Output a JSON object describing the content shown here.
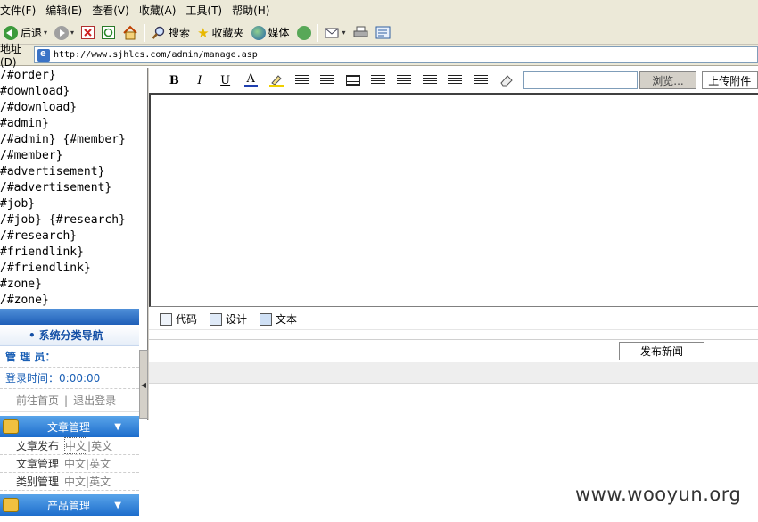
{
  "menubar": {
    "items": [
      "文件(F)",
      "编辑(E)",
      "查看(V)",
      "收藏(A)",
      "工具(T)",
      "帮助(H)"
    ]
  },
  "toolbar": {
    "back": "后退",
    "search": "搜索",
    "favorites": "收藏夹",
    "media": "媒体"
  },
  "address": {
    "label": "地址(D)",
    "url": "http://www.sjhlcs.com/admin/manage.asp"
  },
  "code_lines": [
    "/#order}",
    "#download}",
    "/#download}",
    "#admin}",
    "/#admin} {#member}",
    "/#member}",
    "#advertisement}",
    "/#advertisement}",
    "#job}",
    "/#job} {#research}",
    "/#research}",
    "#friendlink}",
    "/#friendlink}",
    "#zone}",
    "/#zone}"
  ],
  "nav": {
    "title": "系统分类导航",
    "admin_label": "管 理 员：",
    "login_label": "登录时间：",
    "login_time": "0:00:00",
    "home_link": "前往首页",
    "logout_link": "退出登录",
    "groups": [
      {
        "label": "文章管理",
        "items": [
          {
            "label": "文章发布",
            "cn": "中文",
            "en": "英文",
            "boxed": true
          },
          {
            "label": "文章管理",
            "cn": "中文",
            "en": "英文",
            "boxed": false
          },
          {
            "label": "类别管理",
            "cn": "中文",
            "en": "英文",
            "boxed": false
          }
        ]
      },
      {
        "label": "产品管理",
        "items": []
      }
    ]
  },
  "editor": {
    "bold": "B",
    "italic": "I",
    "underline": "U",
    "font_color": "A",
    "browse": "浏览...",
    "upload": "上传附件",
    "modes": [
      "代码",
      "设计",
      "文本"
    ],
    "submit": "发布新闻"
  },
  "watermark": "www.wooyun.org"
}
